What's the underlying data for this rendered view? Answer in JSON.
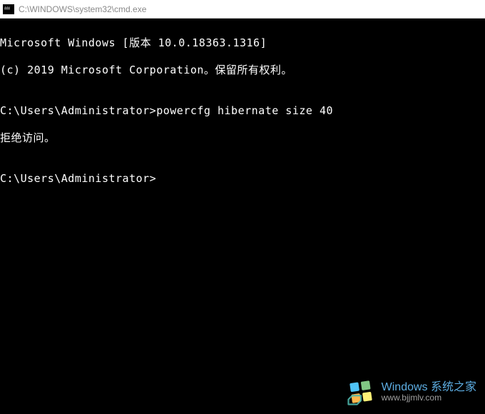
{
  "window": {
    "title": "C:\\WINDOWS\\system32\\cmd.exe"
  },
  "terminal": {
    "line1": "Microsoft Windows [版本 10.0.18363.1316]",
    "line2": "(c) 2019 Microsoft Corporation。保留所有权利。",
    "line3": "",
    "prompt1": "C:\\Users\\Administrator>",
    "command1": "powercfg hibernate size 40",
    "response1": "拒绝访问。",
    "line_blank": "",
    "prompt2": "C:\\Users\\Administrator>"
  },
  "watermark": {
    "title": "Windows 系统之家",
    "url": "www.bjjmlv.com"
  }
}
